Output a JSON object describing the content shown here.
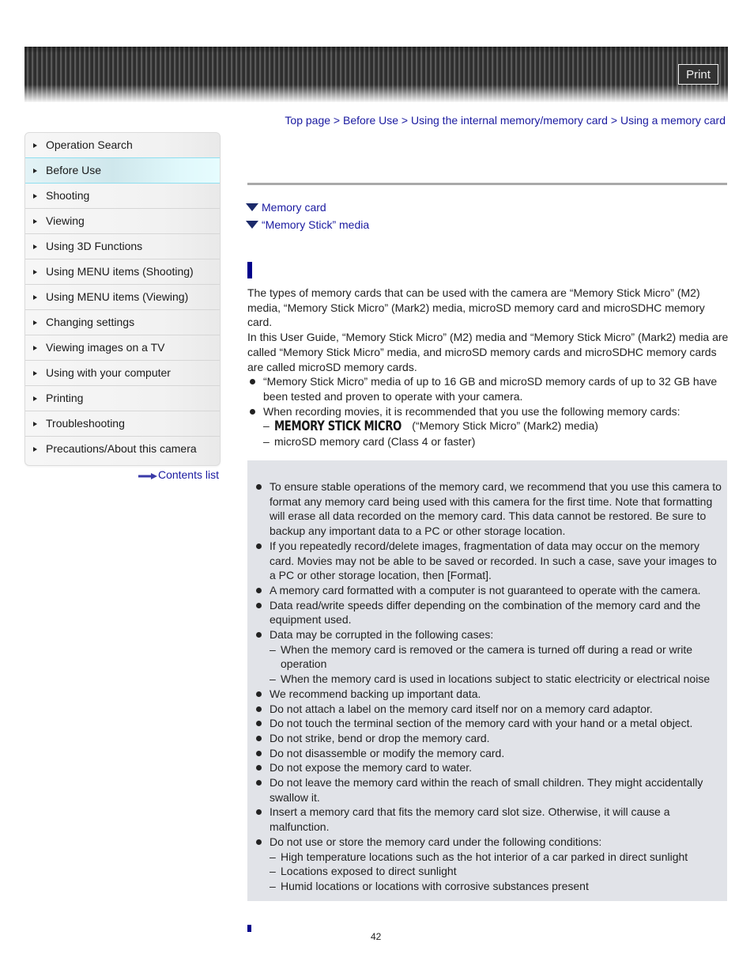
{
  "header": {
    "print_label": "Print"
  },
  "sidebar": {
    "items": [
      {
        "label": "Operation Search",
        "active": false
      },
      {
        "label": "Before Use",
        "active": true
      },
      {
        "label": "Shooting",
        "active": false
      },
      {
        "label": "Viewing",
        "active": false
      },
      {
        "label": "Using 3D Functions",
        "active": false
      },
      {
        "label": "Using MENU items (Shooting)",
        "active": false
      },
      {
        "label": "Using MENU items (Viewing)",
        "active": false
      },
      {
        "label": "Changing settings",
        "active": false
      },
      {
        "label": "Viewing images on a TV",
        "active": false
      },
      {
        "label": "Using with your computer",
        "active": false
      },
      {
        "label": "Printing",
        "active": false
      },
      {
        "label": "Troubleshooting",
        "active": false
      },
      {
        "label": "Precautions/About this camera",
        "active": false
      }
    ],
    "contents_link": "Contents list"
  },
  "breadcrumb": {
    "items": [
      "Top page",
      "Before Use",
      "Using the internal memory/memory card",
      "Using a memory card"
    ],
    "separator": " > "
  },
  "anchors": [
    {
      "label": "Memory card",
      "icon": "triangle-down-icon"
    },
    {
      "label": "“Memory Stick” media",
      "icon": "triangle-down-icon"
    }
  ],
  "memory_card_section": {
    "paragraphs": [
      "The types of memory cards that can be used with the camera are “Memory Stick Micro” (M2) media, “Memory Stick Micro” (Mark2) media, microSD memory card and microSDHC memory card.",
      "In this User Guide, “Memory Stick Micro” (M2) media and “Memory Stick Micro” (Mark2) media are called “Memory Stick Micro” media, and microSD memory cards and microSDHC memory cards are called microSD memory cards."
    ],
    "bullets": [
      "“Memory Stick Micro” media of up to 16 GB and microSD memory cards of up to 32 GB have been tested and proven to operate with your camera.",
      "When recording movies, it is recommended that you use the following memory cards:"
    ],
    "recommended": {
      "logo_text": "MEMORY STICK MICRO",
      "logo_suffix": "(“Memory Stick Micro” (Mark2) media)",
      "microsd": "microSD memory card (Class 4 or faster)"
    }
  },
  "notes": {
    "items": [
      "To ensure stable operations of the memory card, we recommend that you use this camera to format any memory card being used with this camera for the first time. Note that formatting will erase all data recorded on the memory card. This data cannot be restored. Be sure to backup any important data to a PC or other storage location.",
      "If you repeatedly record/delete images, fragmentation of data may occur on the memory card. Movies may not be able to be saved or recorded. In such a case, save your images to a PC or other storage location, then [Format].",
      "A memory card formatted with a computer is not guaranteed to operate with the camera.",
      "Data read/write speeds differ depending on the combination of the memory card and the equipment used.",
      "Data may be corrupted in the following cases:",
      "We recommend backing up important data.",
      "Do not attach a label on the memory card itself nor on a memory card adaptor.",
      "Do not touch the terminal section of the memory card with your hand or a metal object.",
      "Do not strike, bend or drop the memory card.",
      "Do not disassemble or modify the memory card.",
      "Do not expose the memory card to water.",
      "Do not leave the memory card within the reach of small children. They might accidentally swallow it.",
      "Insert a memory card that fits the memory card slot size. Otherwise, it will cause a malfunction.",
      "Do not use or store the memory card under the following conditions:"
    ],
    "corruption_cases": [
      "When the memory card is removed or the camera is turned off during a read or write operation",
      "When the memory card is used in locations subject to static electricity or electrical noise"
    ],
    "storage_conditions": [
      "High temperature locations such as the hot interior of a car parked in direct sunlight",
      "Locations exposed to direct sunlight",
      "Humid locations or locations with corrosive substances present"
    ]
  },
  "footer": {
    "page_number": "42"
  }
}
